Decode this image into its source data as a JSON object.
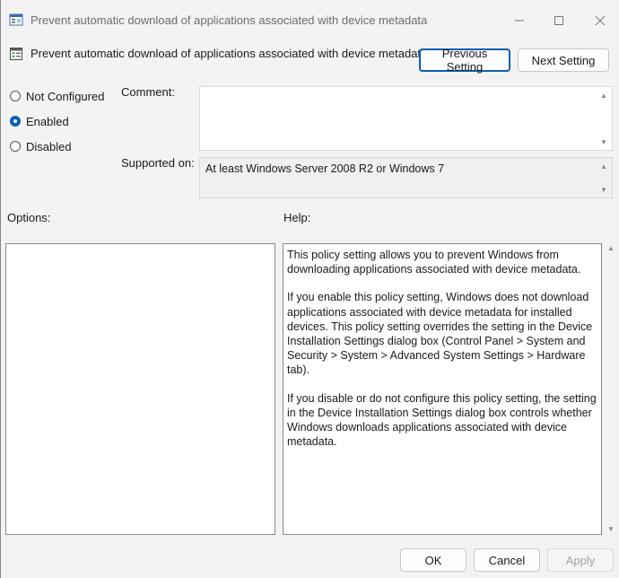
{
  "window": {
    "title": "Prevent automatic download of applications associated with device metadata"
  },
  "header": {
    "policy_title": "Prevent automatic download of applications associated with device metadata",
    "previous_label": "Previous Setting",
    "next_label": "Next Setting"
  },
  "state": {
    "options": [
      "Not Configured",
      "Enabled",
      "Disabled"
    ],
    "selected": "Enabled"
  },
  "labels": {
    "comment": "Comment:",
    "supported_on": "Supported on:",
    "options": "Options:",
    "help": "Help:"
  },
  "supported_on_value": "At least Windows Server 2008 R2 or Windows 7",
  "comment_value": "",
  "help_text": [
    "This policy setting allows you to prevent Windows from downloading applications associated with device metadata.",
    "If you enable this policy setting, Windows does not download applications associated with device metadata for installed devices. This policy setting overrides the setting in the Device Installation Settings dialog box (Control Panel > System and Security > System > Advanced System Settings > Hardware tab).",
    "If you disable or do not configure this policy setting, the setting in the Device Installation Settings dialog box controls whether Windows downloads applications associated with device metadata."
  ],
  "footer": {
    "ok_label": "OK",
    "cancel_label": "Cancel",
    "apply_label": "Apply"
  },
  "icons": {
    "title": "policy-window-icon",
    "policy": "policy-setting-icon",
    "minimize": "minimize-icon",
    "maximize": "maximize-icon",
    "close": "close-icon"
  },
  "colors": {
    "accent": "#0a5fb4",
    "background": "#f3f3f3"
  }
}
